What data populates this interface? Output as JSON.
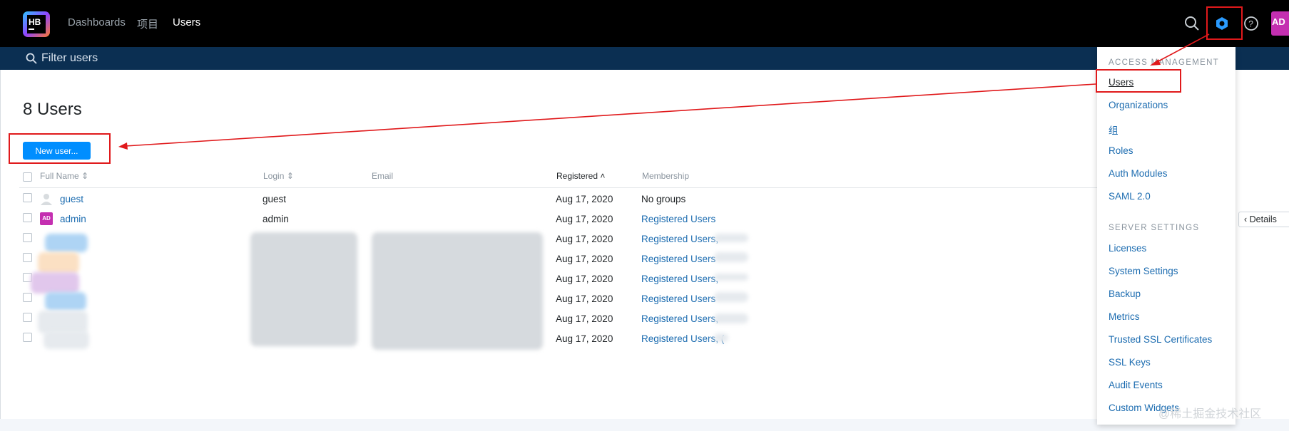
{
  "topbar": {
    "logo_text": "HB",
    "nav": [
      "Dashboards",
      "项目",
      "Users"
    ],
    "avatar_initials": "AD",
    "icons": [
      "search-icon",
      "settings-hexagon-icon",
      "help-icon"
    ]
  },
  "filter": {
    "placeholder": "Filter users"
  },
  "page": {
    "title": "8 Users",
    "new_user_label": "New user...",
    "columns": [
      "Full Name",
      "Login",
      "Email",
      "Registered",
      "Membership"
    ],
    "sort_column": "Registered"
  },
  "users": [
    {
      "name": "guest",
      "login": "guest",
      "registered": "Aug 17, 2020",
      "membership": "No groups"
    },
    {
      "name": "admin",
      "avatar": "AD",
      "login": "admin",
      "registered": "Aug 17, 2020",
      "membership": "Registered Users"
    },
    {
      "registered": "Aug 17, 2020",
      "membership": "Registered Users, "
    },
    {
      "registered": "Aug 17, 2020",
      "membership": "Registered Users"
    },
    {
      "registered": "Aug 17, 2020",
      "membership": "Registered Users,"
    },
    {
      "registered": "Aug 17, 2020",
      "membership": "Registered Users"
    },
    {
      "registered": "Aug 17, 2020",
      "membership": "Registered Users,"
    },
    {
      "registered": "Aug 17, 2020",
      "membership": "Registered Users, ("
    }
  ],
  "details_label": "Details",
  "menu": {
    "access_header": "ACCESS MANAGEMENT",
    "access_items": [
      "Users",
      "Organizations",
      "组",
      "Roles",
      "Auth Modules",
      "SAML 2.0"
    ],
    "server_header": "SERVER SETTINGS",
    "server_items": [
      "Licenses",
      "System Settings",
      "Backup",
      "Metrics",
      "Trusted SSL Certificates",
      "SSL Keys",
      "Audit Events",
      "Custom Widgets"
    ]
  },
  "watermark": "@稀土掘金技术社区",
  "colors": {
    "topbar": "#000000",
    "filterbar": "#0b2f52",
    "accent": "#008eff",
    "link": "#1c6cb0",
    "annotation": "#e0191b",
    "avatar": "#c42fb0"
  }
}
